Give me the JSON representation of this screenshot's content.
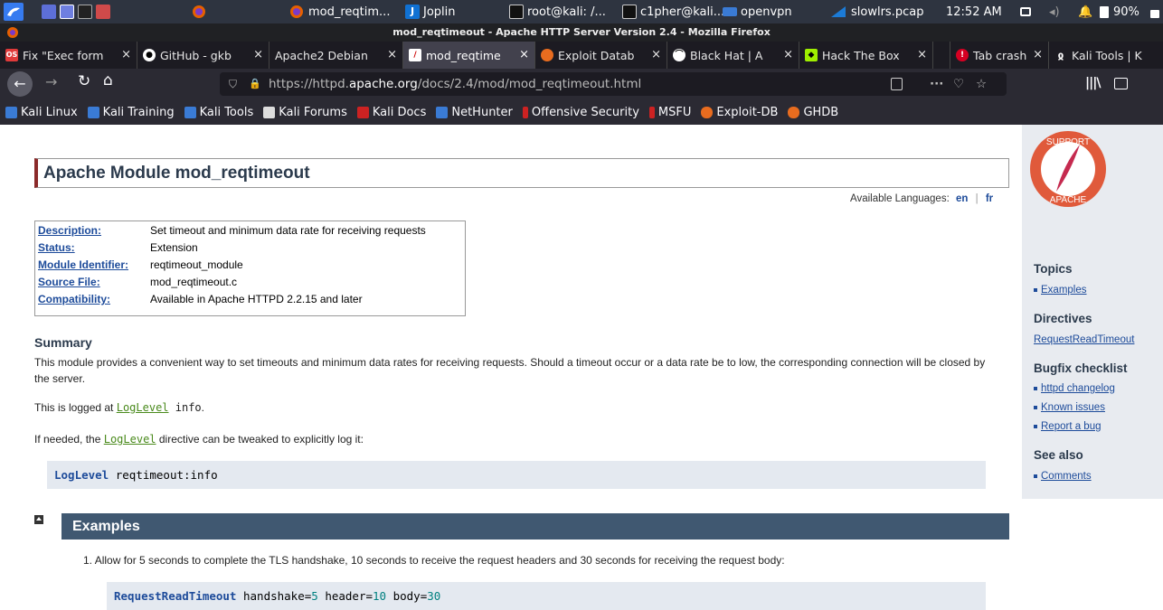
{
  "taskbar": {
    "app_menu": "Kali",
    "windows": [
      {
        "label": "mod_reqtim..."
      },
      {
        "label": "Joplin"
      },
      {
        "label": "root@kali: /..."
      },
      {
        "label": "c1pher@kali..."
      },
      {
        "label": "openvpn"
      },
      {
        "label": "slowlrs.pcap"
      }
    ],
    "clock": "12:52 AM",
    "battery": "90%"
  },
  "window_title": "mod_reqtimeout - Apache HTTP Server Version 2.4 - Mozilla Firefox",
  "tabs": [
    {
      "label": "Fix \"Exec form",
      "close": "×"
    },
    {
      "label": "GitHub - gkb",
      "close": "×"
    },
    {
      "label": "Apache2 Debian",
      "close": "×"
    },
    {
      "label": "mod_reqtime",
      "close": "×"
    },
    {
      "label": "Exploit Datab",
      "close": "×"
    },
    {
      "label": "Black Hat | A",
      "close": "×"
    },
    {
      "label": "Hack The Box",
      "close": "×"
    },
    {
      "label": "Tab crash",
      "close": "×"
    },
    {
      "label": "Kali Tools | K",
      "close": ""
    }
  ],
  "nav": {
    "url_prefix": "https://httpd.",
    "url_domain": "apache.org",
    "url_path": "/docs/2.4/mod/mod_reqtimeout.html",
    "overflow": "···"
  },
  "bookmarks": [
    {
      "label": "Kali Linux",
      "color": "#3a7bd5"
    },
    {
      "label": "Kali Training",
      "color": "#3a7bd5"
    },
    {
      "label": "Kali Tools",
      "color": "#3a7bd5"
    },
    {
      "label": "Kali Forums",
      "color": "#dddddd"
    },
    {
      "label": "Kali Docs",
      "color": "#cc2222"
    },
    {
      "label": "NetHunter",
      "color": "#3a7bd5"
    },
    {
      "label": "Offensive Security",
      "color": "#cc2222"
    },
    {
      "label": "MSFU",
      "color": "#cc2222"
    },
    {
      "label": "Exploit-DB",
      "color": "#e86c1f"
    },
    {
      "label": "GHDB",
      "color": "#e86c1f"
    }
  ],
  "page": {
    "title": "Apache Module mod_reqtimeout",
    "available_languages_label": "Available Languages:",
    "lang_en": "en",
    "lang_sep": "|",
    "lang_fr": "fr",
    "module_info": [
      {
        "key": "Description:",
        "value": "Set timeout and minimum data rate for receiving requests"
      },
      {
        "key": "Status:",
        "value": "Extension"
      },
      {
        "key": "Module Identifier:",
        "value": "reqtimeout_module"
      },
      {
        "key": "Source File:",
        "value": "mod_reqtimeout.c"
      },
      {
        "key": "Compatibility:",
        "value": "Available in Apache HTTPD 2.2.15 and later"
      }
    ],
    "summary_heading": "Summary",
    "summary_p1": "This module provides a convenient way to set timeouts and minimum data rates for receiving requests. Should a timeout occur or a data rate be to low, the corresponding connection will be closed by the server.",
    "p2_before": "This is logged at ",
    "p2_link": "LogLevel",
    "p2_after": " info",
    "p2_end": ".",
    "p3_before": "If needed, the ",
    "p3_link": "LogLevel",
    "p3_after": " directive can be tweaked to explicitly log it:",
    "code1_kw": "LogLevel",
    "code1_rest": " reqtimeout:info",
    "examples_heading": "Examples",
    "example1_num": "1.",
    "example1_text": "Allow for 5 seconds to complete the TLS handshake, 10 seconds to receive the request headers and 30 seconds for receiving the request body:",
    "code2_kw": "RequestReadTimeout",
    "code2_p1": " handshake=",
    "code2_v1": "5",
    "code2_p2": " header=",
    "code2_v2": "10",
    "code2_p3": " body=",
    "code2_v3": "30"
  },
  "sidebar": {
    "logo_text_top": "SUPPORT",
    "logo_text_bottom": "APACHE",
    "topics_heading": "Topics",
    "topics": [
      "Examples"
    ],
    "directives_heading": "Directives",
    "directives": [
      "RequestReadTimeout"
    ],
    "bugfix_heading": "Bugfix checklist",
    "bugfix": [
      "httpd changelog",
      "Known issues",
      "Report a bug"
    ],
    "seealso_heading": "See also",
    "seealso": [
      "Comments"
    ]
  }
}
